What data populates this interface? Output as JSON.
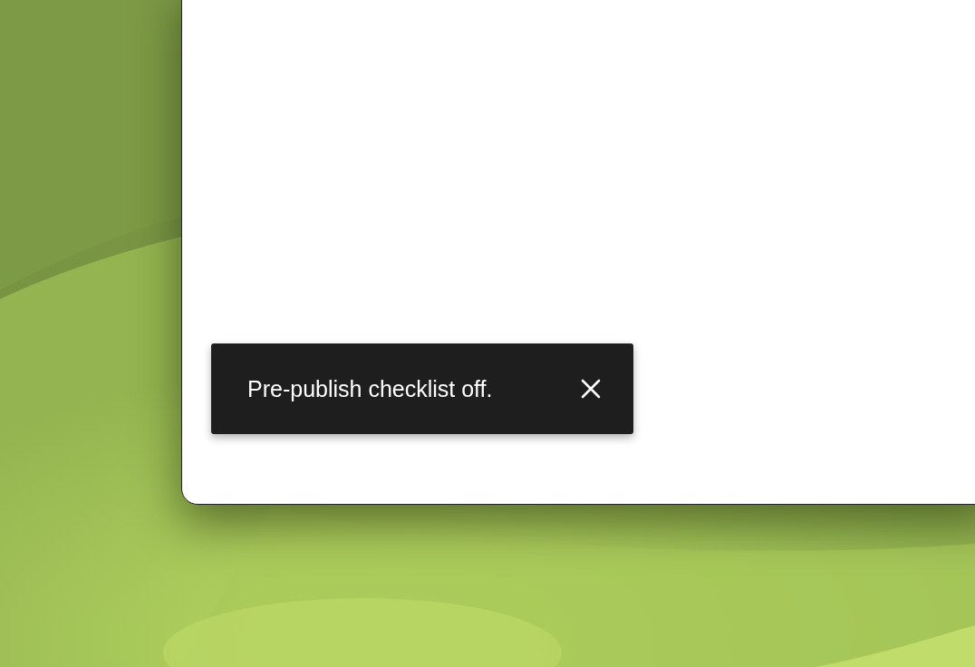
{
  "snackbar": {
    "message": "Pre-publish checklist off.",
    "dismissible": true
  }
}
